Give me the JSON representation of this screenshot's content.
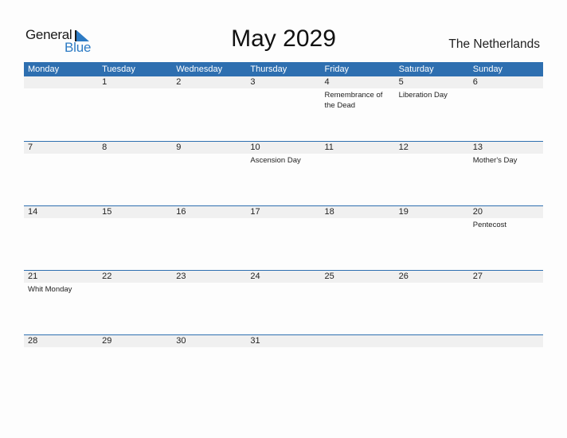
{
  "logo": {
    "line1": "General",
    "line2": "Blue"
  },
  "title": "May 2029",
  "country": "The Netherlands",
  "colors": {
    "accent": "#2e6fb0",
    "band": "#f0f0f0",
    "logo_blue": "#2d7bc4"
  },
  "weekdays": [
    "Monday",
    "Tuesday",
    "Wednesday",
    "Thursday",
    "Friday",
    "Saturday",
    "Sunday"
  ],
  "weeks": [
    [
      {
        "day": "",
        "holiday": ""
      },
      {
        "day": "1",
        "holiday": ""
      },
      {
        "day": "2",
        "holiday": ""
      },
      {
        "day": "3",
        "holiday": ""
      },
      {
        "day": "4",
        "holiday": "Remembrance of the Dead"
      },
      {
        "day": "5",
        "holiday": "Liberation Day"
      },
      {
        "day": "6",
        "holiday": ""
      }
    ],
    [
      {
        "day": "7",
        "holiday": ""
      },
      {
        "day": "8",
        "holiday": ""
      },
      {
        "day": "9",
        "holiday": ""
      },
      {
        "day": "10",
        "holiday": "Ascension Day"
      },
      {
        "day": "11",
        "holiday": ""
      },
      {
        "day": "12",
        "holiday": ""
      },
      {
        "day": "13",
        "holiday": "Mother's Day"
      }
    ],
    [
      {
        "day": "14",
        "holiday": ""
      },
      {
        "day": "15",
        "holiday": ""
      },
      {
        "day": "16",
        "holiday": ""
      },
      {
        "day": "17",
        "holiday": ""
      },
      {
        "day": "18",
        "holiday": ""
      },
      {
        "day": "19",
        "holiday": ""
      },
      {
        "day": "20",
        "holiday": "Pentecost"
      }
    ],
    [
      {
        "day": "21",
        "holiday": "Whit Monday"
      },
      {
        "day": "22",
        "holiday": ""
      },
      {
        "day": "23",
        "holiday": ""
      },
      {
        "day": "24",
        "holiday": ""
      },
      {
        "day": "25",
        "holiday": ""
      },
      {
        "day": "26",
        "holiday": ""
      },
      {
        "day": "27",
        "holiday": ""
      }
    ],
    [
      {
        "day": "28",
        "holiday": ""
      },
      {
        "day": "29",
        "holiday": ""
      },
      {
        "day": "30",
        "holiday": ""
      },
      {
        "day": "31",
        "holiday": ""
      },
      {
        "day": "",
        "holiday": ""
      },
      {
        "day": "",
        "holiday": ""
      },
      {
        "day": "",
        "holiday": ""
      }
    ]
  ]
}
